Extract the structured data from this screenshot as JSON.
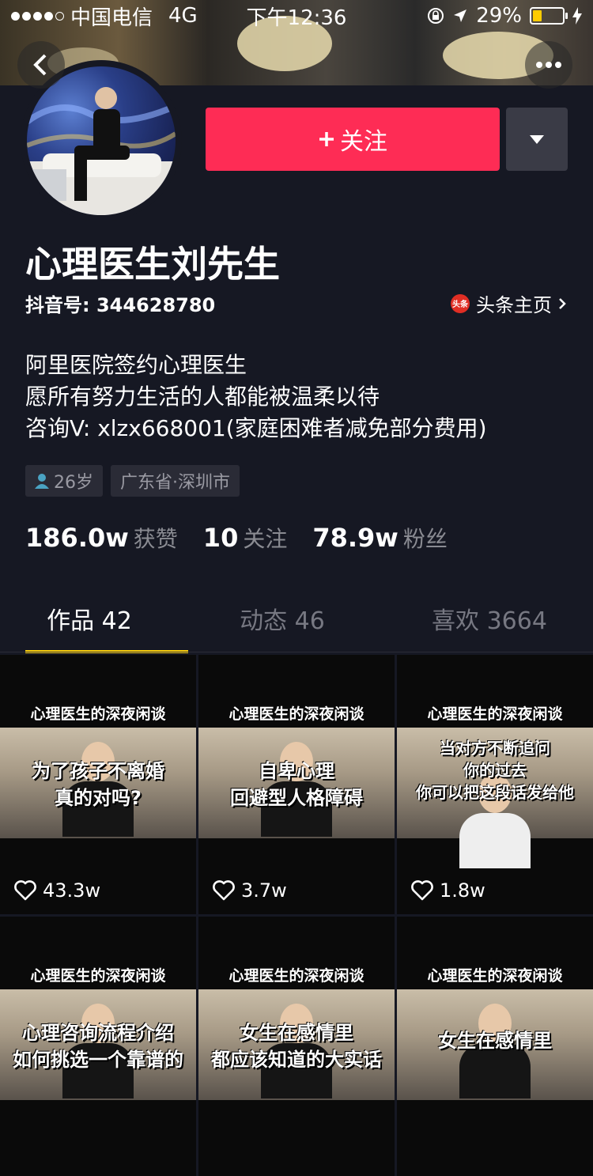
{
  "status_bar": {
    "carrier": "中国电信",
    "network": "4G",
    "time": "下午12:36",
    "battery": "29%",
    "battery_level": 0.29
  },
  "profile": {
    "name": "心理医生刘先生",
    "douyin_id": "抖音号: 344628780",
    "toutiao_badge": "头条",
    "toutiao_link": "头条主页",
    "follow_label": "关注",
    "bio": [
      "阿里医院签约心理医生",
      "愿所有努力生活的人都能被温柔以待",
      "咨询V: xlzx668001(家庭困难者减免部分费用)"
    ],
    "tags": {
      "age": "26岁",
      "location": "广东省·深圳市"
    },
    "stats": [
      {
        "num": "186.0w",
        "label": "获赞"
      },
      {
        "num": "10",
        "label": "关注"
      },
      {
        "num": "78.9w",
        "label": "粉丝"
      }
    ]
  },
  "tabs": [
    {
      "label": "作品 42",
      "active": true
    },
    {
      "label": "动态 46",
      "active": false
    },
    {
      "label": "喜欢 3664",
      "active": false
    }
  ],
  "videos": [
    {
      "banner": "心理医生的深夜闲谈",
      "caption": [
        "为了孩子不离婚",
        "真的对吗?"
      ],
      "likes": "43.3w"
    },
    {
      "banner": "心理医生的深夜闲谈",
      "caption": [
        "自卑心理",
        "回避型人格障碍"
      ],
      "likes": "3.7w"
    },
    {
      "banner": "心理医生的深夜闲谈",
      "caption": [
        "当对方不断追问",
        "你的过去",
        "你可以把这段话发给他"
      ],
      "likes": "1.8w"
    },
    {
      "banner": "心理医生的深夜闲谈",
      "caption": [
        "心理咨询流程介绍",
        "如何挑选一个靠谱的"
      ],
      "likes": ""
    },
    {
      "banner": "心理医生的深夜闲谈",
      "caption": [
        "女生在感情里",
        "都应该知道的大实话"
      ],
      "likes": ""
    },
    {
      "banner": "心理医生的深夜闲谈",
      "caption": [
        "女生在感情里"
      ],
      "likes": ""
    }
  ]
}
